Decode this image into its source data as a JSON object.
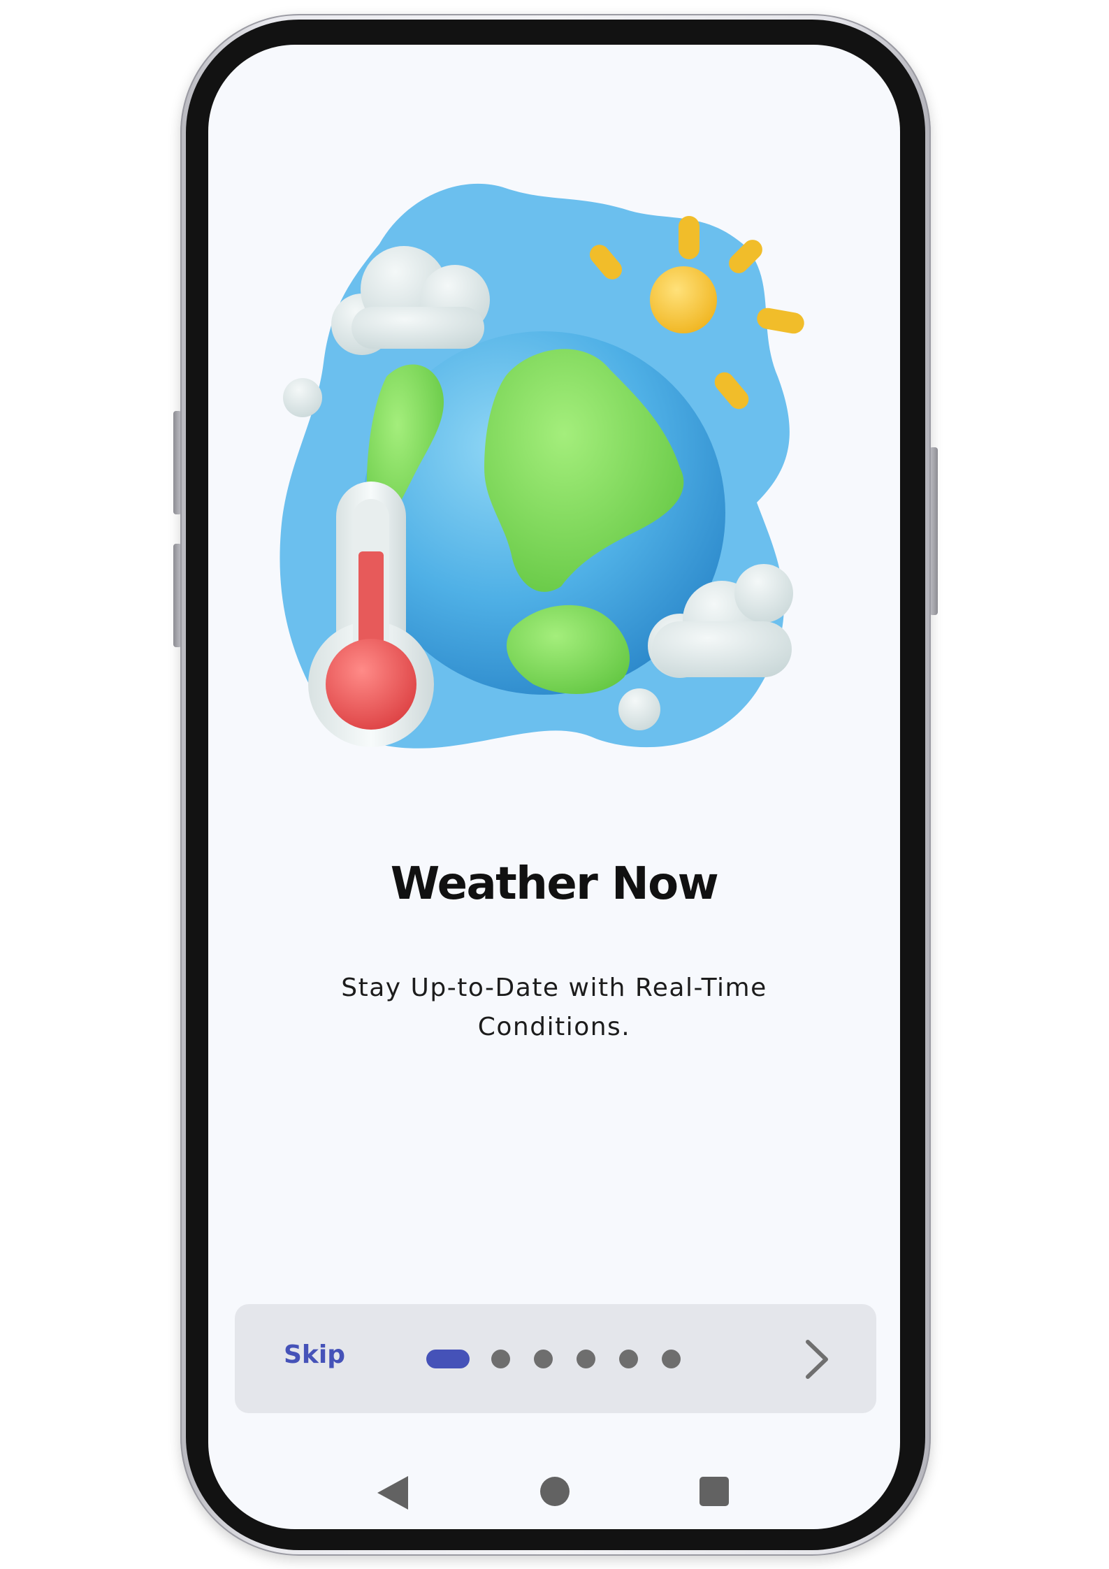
{
  "onboarding": {
    "title": "Weather Now",
    "subtitle": "Stay Up-to-Date with Real-Time Conditions.",
    "illustration_icon": "earth-weather-illustration",
    "skip_label": "Skip",
    "page_indicator": {
      "total": 6,
      "current": 1
    },
    "next_icon": "chevron-right-icon"
  },
  "colors": {
    "accent": "#4552b8",
    "screen_background": "#f7f9fd",
    "bottom_bar": "#e4e6eb",
    "blob": "#6bbfee",
    "dot_inactive": "#6e6e6e"
  },
  "system_nav": {
    "back_icon": "back-triangle-icon",
    "home_icon": "home-circle-icon",
    "recents_icon": "recents-square-icon"
  }
}
